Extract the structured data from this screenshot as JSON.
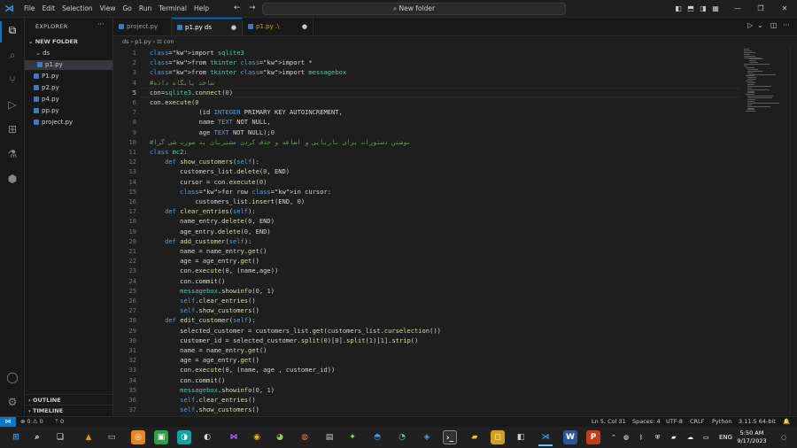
{
  "window": {
    "menu": [
      "File",
      "Edit",
      "Selection",
      "View",
      "Go",
      "Run",
      "Terminal",
      "Help"
    ],
    "search_placeholder": "New folder",
    "nav_back": "←",
    "nav_forward": "→"
  },
  "sidebar": {
    "title": "EXPLORER",
    "more": "···",
    "folder": "NEW FOLDER",
    "subfolder": "ds",
    "items": [
      "p1.py",
      "P1.py",
      "p2.py",
      "p4.py",
      "pp.py",
      "project.py"
    ],
    "outline": "OUTLINE",
    "timeline": "TIMELINE"
  },
  "tabs": [
    {
      "label": "project.py"
    },
    {
      "label": "p1.py ds",
      "dirty": "●"
    },
    {
      "label": "p1.py .\\",
      "dirty": "●"
    }
  ],
  "breadcrumb": "ds  ›  p1.py  ›  ⊡ con",
  "editor": {
    "current_line": 5,
    "lines": [
      "import sqlite3",
      "from tkinter import *",
      "from tkinter import messagebox",
      "#ساخت پایگاه داده",
      "con=sqlite3.connect('mydb.db')",
      "con.execute('''CREATE TABLE IF NOT EXISTS cur",
      "             (id INTEGER PRIMARY KEY AUTOINCREMENT,",
      "             name TEXT NOT NULL,",
      "             age TEXT NOT NULL);''')",
      "#نوشتن دستورات برای بازیابی و اضافه و حذف کردن مشتریان به صورت شی گرا",
      "class mc2:",
      "    def show_customers(self):",
      "        customers_list.delete(0, END)",
      "        cursor = con.execute(\"SELECT * FROM cur\")",
      "        for row in cursor:",
      "            customers_list.insert(END, f\"ID: {row[0]}, Name: {row[1]},age: {row[2]}\")",
      "    def clear_entries(self):",
      "        name_entry.delete(0, END)",
      "        age_entry.delete(0, END)",
      "    def add_customer(self):",
      "        name = name_entry.get()",
      "        age = age_entry.get()",
      "        con.execute(\"INSERT INTO cur (name,age) VALUES (?,?)\", (name,age))",
      "        con.commit()",
      "        messagebox.showinfo(\"Success\", \"Customer added successfully\")",
      "        self.clear_entries()",
      "        self.show_customers()",
      "    def edit_customer(self):",
      "        selected_customer = customers_list.get(customers_list.curselection())",
      "        customer_id = selected_customer.split(',')[0].split(':')[1].strip()",
      "        name = name_entry.get()",
      "        age = age_entry.get()",
      "        con.execute(\"UPDATE cur SET name = ?, age = ? WHERE id = ?\", (name, age , customer_id))",
      "        con.commit()",
      "        messagebox.showinfo(\"Success\", \"Customer updated successfully\")",
      "        self.clear_entries()",
      "        self.show_customers()",
      "    def delete_customer(self):"
    ]
  },
  "statusbar": {
    "remote": "⋈",
    "problems": "⊗ 0 ⚠ 0",
    "ports": "ᛘ 0",
    "position": "Ln 5, Col 31",
    "spaces": "Spaces: 4",
    "encoding": "UTF-8",
    "eol": "CRLF",
    "language": "Python",
    "interpreter": "3.11.5 64-bit",
    "bell": "🔔"
  },
  "taskbar": {
    "lang": "ENG",
    "time": "5:50 AM",
    "date": "9/17/2023"
  },
  "colors": {
    "accent": "#0078d4",
    "keyword": "#c586c0",
    "string": "#ce9178",
    "comment": "#6a9955",
    "function": "#dcdcaa"
  }
}
